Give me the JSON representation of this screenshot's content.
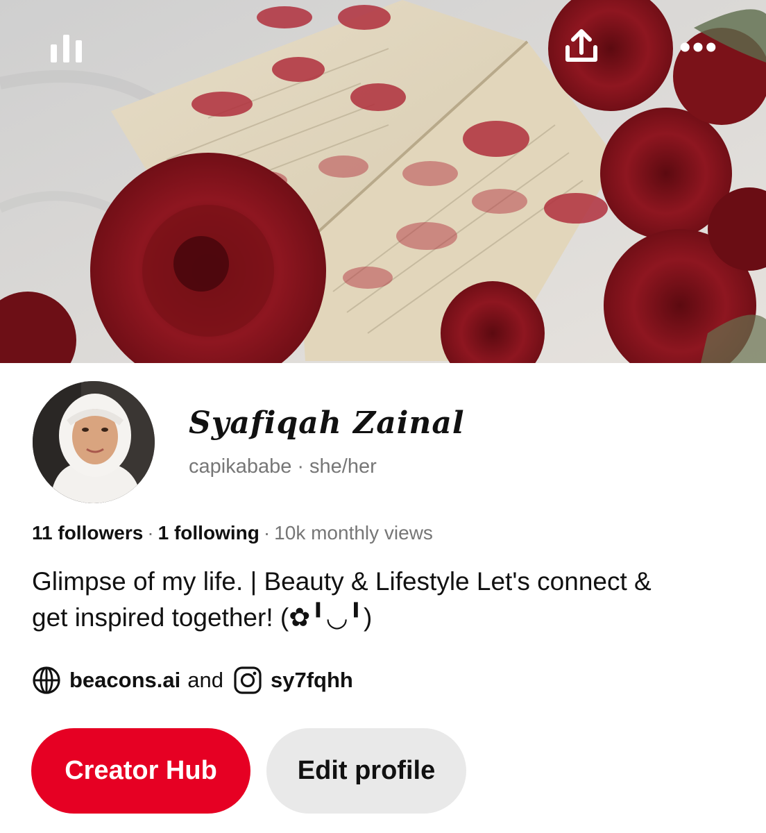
{
  "header": {
    "icons": [
      "stats-icon",
      "share-icon",
      "more-icon"
    ]
  },
  "profile": {
    "display_name": "Syafiqah Zainal",
    "handle": "capikababe",
    "separator": "·",
    "pronouns": "she/her",
    "followers": "11 followers",
    "following": "1 following",
    "monthly_views": "10k monthly views",
    "bio": "Glimpse of my life.  | Beauty & Lifestyle Let's connect & get inspired together! (✿╹◡╹)",
    "links": {
      "website": "beacons.ai",
      "joiner": "and",
      "instagram": "sy7fqhh"
    }
  },
  "actions": {
    "primary": "Creator Hub",
    "secondary": "Edit profile"
  },
  "colors": {
    "accent": "#e60023",
    "secondary_button": "#e9e9e9",
    "muted_text": "#767676"
  }
}
